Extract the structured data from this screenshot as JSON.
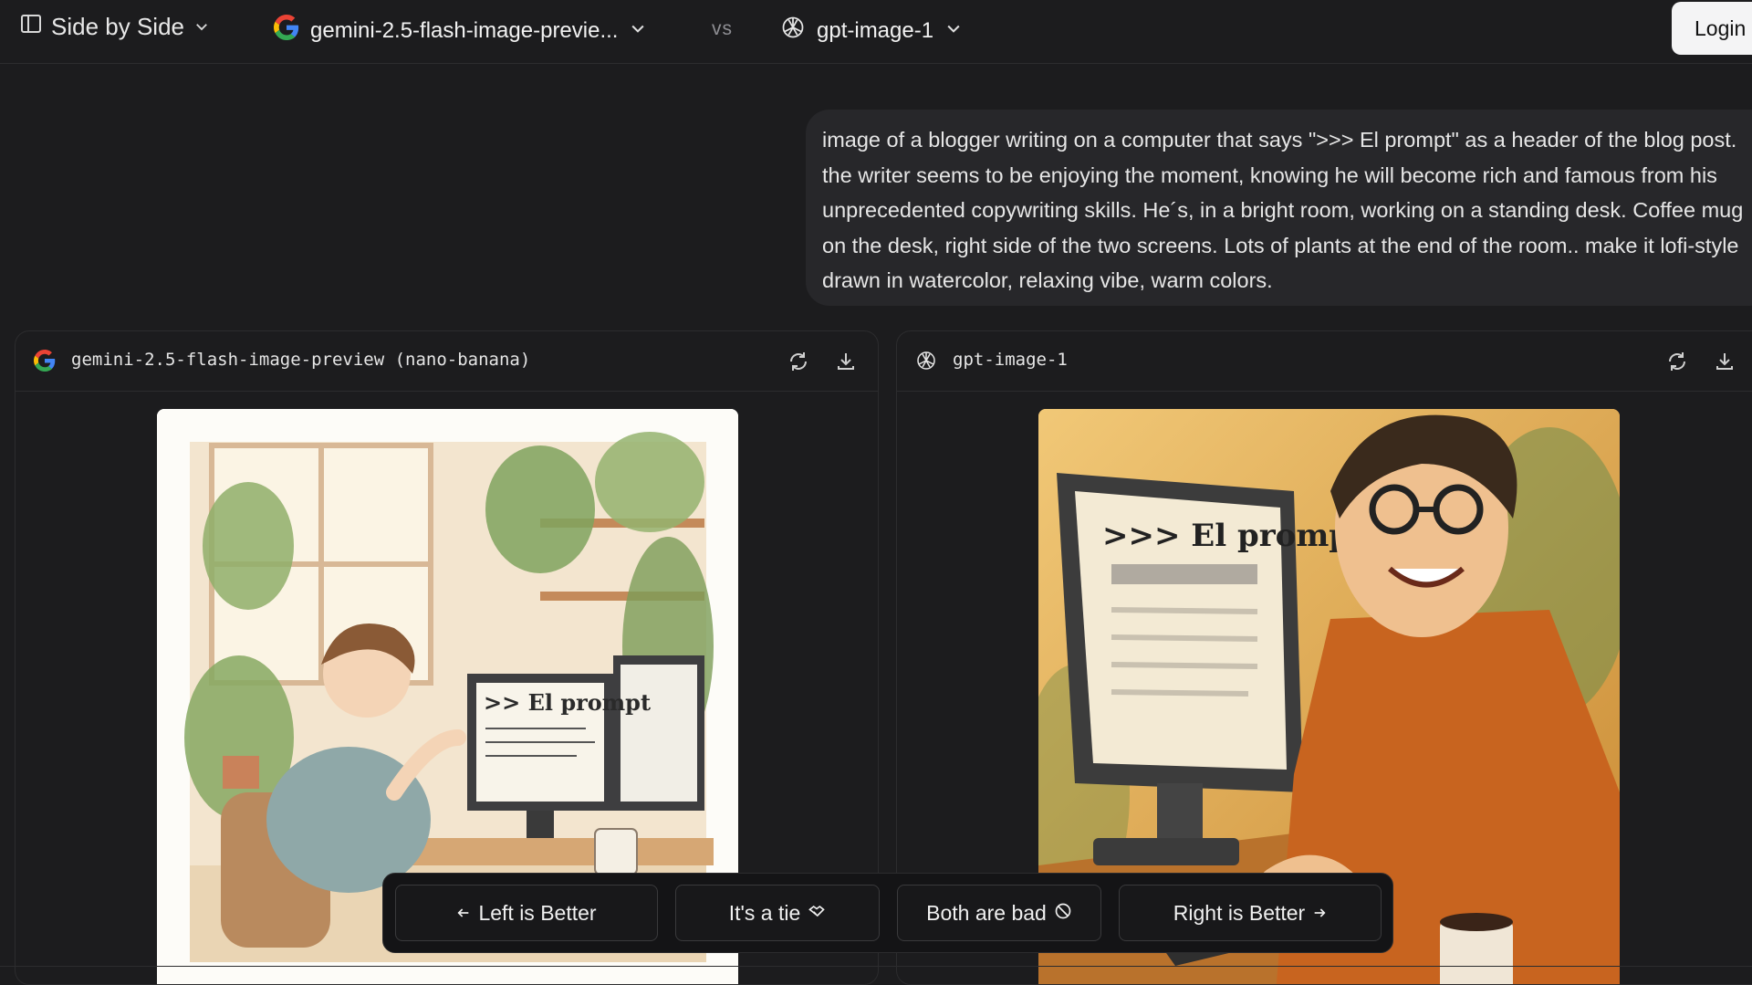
{
  "header": {
    "mode_label": "Side by Side",
    "left_model": "gemini-2.5-flash-image-previe...",
    "vs_label": "vs",
    "right_model": "gpt-image-1",
    "login_label": "Login"
  },
  "prompt": {
    "text": "image of a blogger writing on a computer that says \">>> El prompt\" as a header of the blog post. the writer seems to be enjoying the moment, knowing he will become rich and famous from his unprecedented copywriting skills. He´s, in a bright room, working on a standing desk. Coffee mug on the desk, right side of the two screens. Lots of plants at the end of the room.. make it lofi-style drawn in watercolor, relaxing vibe, warm colors."
  },
  "panels": {
    "left": {
      "title": "gemini-2.5-flash-image-preview (nano-banana)",
      "screen_text": ">> El prompt"
    },
    "right": {
      "title": "gpt-image-1",
      "screen_text": ">>> El prompt"
    }
  },
  "vote": {
    "left_better": "Left is Better",
    "tie": "It's a tie",
    "both_bad": "Both are bad",
    "right_better": "Right is Better"
  },
  "icons": {
    "mode": "sidebar-layout-icon",
    "google": "google-g-icon",
    "openai": "openai-logo-icon",
    "regenerate": "refresh-icon",
    "download": "download-icon"
  },
  "colors": {
    "background": "#1c1c1e",
    "prompt_bubble": "#27272a",
    "login_bg": "#f4f4f5"
  }
}
